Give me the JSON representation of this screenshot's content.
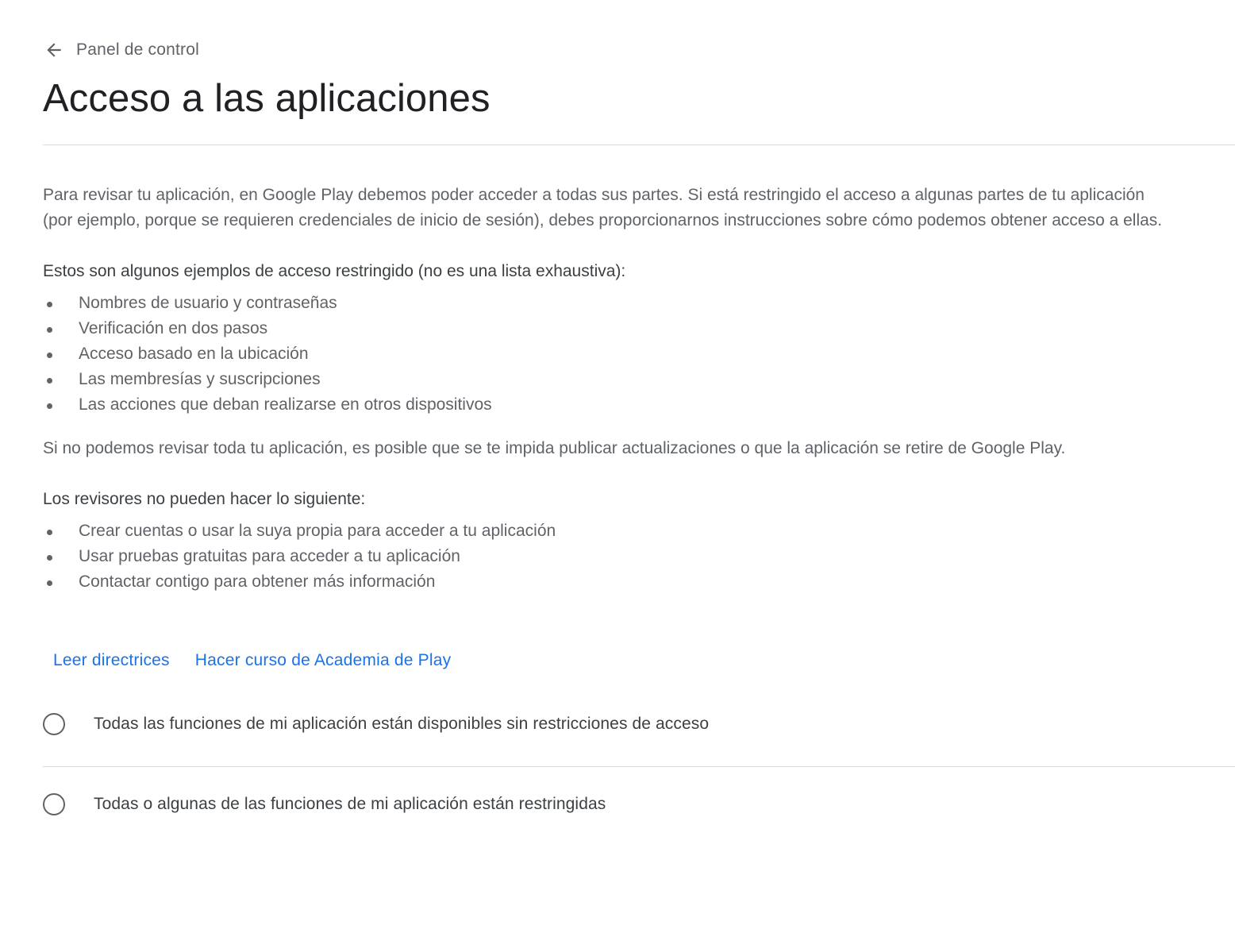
{
  "header": {
    "back_label": "Panel de control",
    "back_icon": "arrow-left-icon",
    "title": "Acceso a las aplicaciones"
  },
  "main": {
    "intro": "Para revisar tu aplicación, en Google Play debemos poder acceder a todas sus partes. Si está restringido el acceso a algunas partes de tu aplicación (por ejemplo, porque se requieren credenciales de inicio de sesión), debes proporcionarnos instrucciones sobre cómo podemos obtener acceso a ellas.",
    "examples_heading": "Estos son algunos ejemplos de acceso restringido (no es una lista exhaustiva):",
    "examples": [
      "Nombres de usuario y contraseñas",
      "Verificación en dos pasos",
      "Acceso basado en la ubicación",
      "Las membresías y suscripciones",
      "Las acciones que deban realizarse en otros dispositivos"
    ],
    "warning": "Si no podemos revisar toda tu aplicación, es posible que se te impida publicar actualizaciones o que la aplicación se retire de Google Play.",
    "reviewers_heading": "Los revisores no pueden hacer lo siguiente:",
    "reviewers": [
      "Crear cuentas o usar la suya propia para acceder a tu aplicación",
      "Usar pruebas gratuitas para acceder a tu aplicación",
      "Contactar contigo para obtener más información"
    ],
    "links": {
      "guidelines": "Leer directrices",
      "academy": "Hacer curso de Academia de Play"
    },
    "options": {
      "all_available": "Todas las funciones de mi aplicación están disponibles sin restricciones de acceso",
      "restricted": "Todas o algunas de las funciones de mi aplicación están restringidas"
    }
  },
  "colors": {
    "link": "#1a73e8",
    "title": "#202124",
    "body": "#5f6368",
    "divider": "#dadce0"
  }
}
